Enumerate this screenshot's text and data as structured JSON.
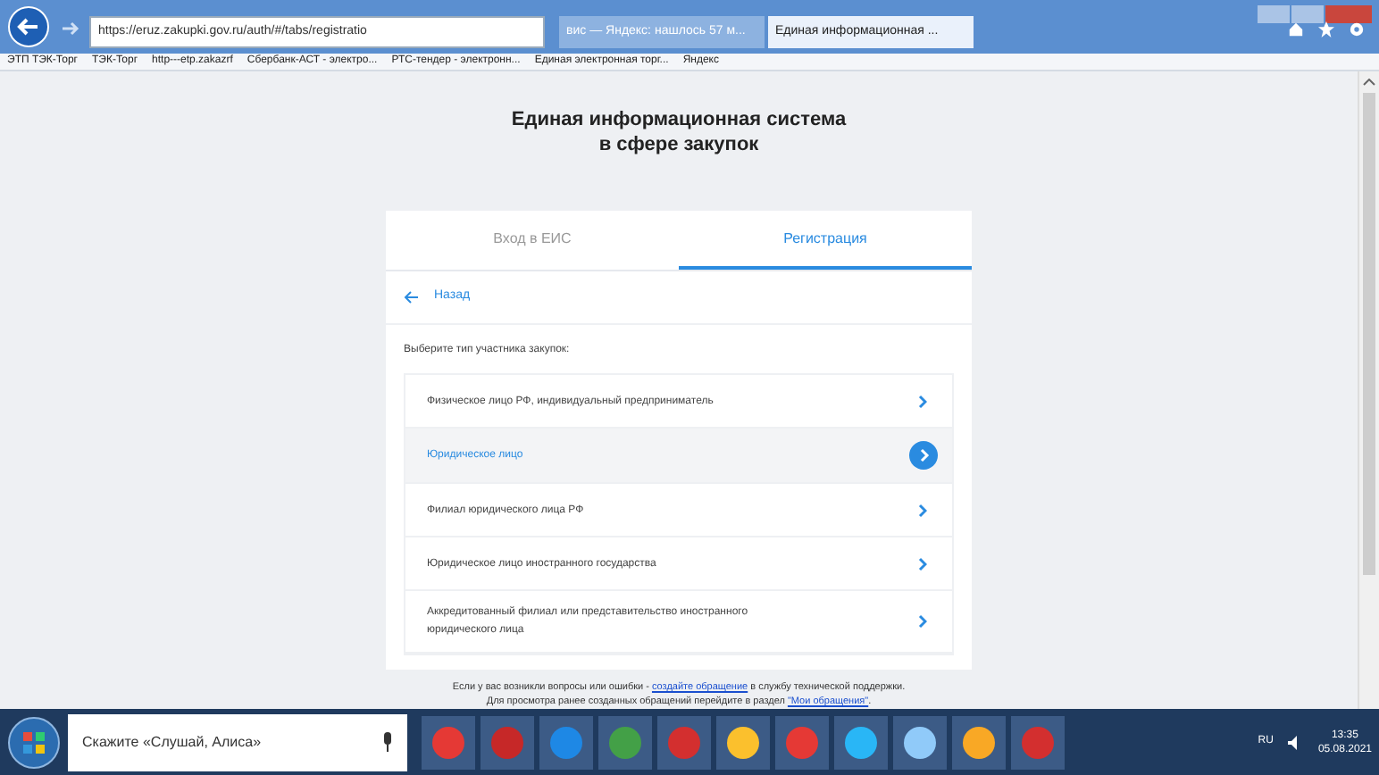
{
  "browser": {
    "address": "https://eruz.zakupki.gov.ru/auth/#/tabs/registratio",
    "tabs": [
      {
        "label": "вис — Яндекс: нашлось 57 м...",
        "selected": false
      },
      {
        "label": "Единая информационная ...",
        "selected": true
      }
    ],
    "bookmarks": [
      "ЭТП ТЭК-Торг",
      "ТЭК-Торг",
      "http---etp.zakazrf",
      "Сбербанк-АСТ - электро...",
      "РТС-тендер - электронн...",
      "Единая электронная торг...",
      "Яндекс"
    ]
  },
  "page": {
    "title": [
      "Единая информационная система",
      "в сфере закупок"
    ],
    "tabs": [
      {
        "label": "Вход в ЕИС",
        "selected": false
      },
      {
        "label": "Регистрация",
        "selected": true
      }
    ],
    "back_link": "Назад",
    "prompt": "Выберите тип участника закупок:",
    "options": [
      {
        "label": "Физическое лицо РФ, индивидуальный предприниматель",
        "selected": false
      },
      {
        "label": "Юридическое лицо",
        "selected": true
      },
      {
        "label": "Филиал юридического лица РФ",
        "selected": false
      },
      {
        "label": "Юридическое лицо иностранного государства",
        "selected": false
      },
      {
        "label": "Аккредитованный филиал или представительство иностранного юридического лица",
        "selected": false
      }
    ],
    "footer": [
      [
        {
          "kind": "text",
          "text": "Если у вас возникли вопросы или ошибки - "
        },
        {
          "kind": "link",
          "text": "создайте обращение"
        },
        {
          "kind": "text",
          "text": " в службу технической поддержки."
        }
      ],
      [
        {
          "kind": "text",
          "text": "Для просмотра ранее созданных обращений перейдите в раздел "
        },
        {
          "kind": "link",
          "text": "\"Мои обращения\""
        },
        {
          "kind": "text",
          "text": "."
        }
      ]
    ]
  },
  "taskbar": {
    "search_placeholder": "Скажите «Слушай, Алиса»",
    "language": "RU",
    "time": "13:35",
    "date": "05.08.2021"
  }
}
